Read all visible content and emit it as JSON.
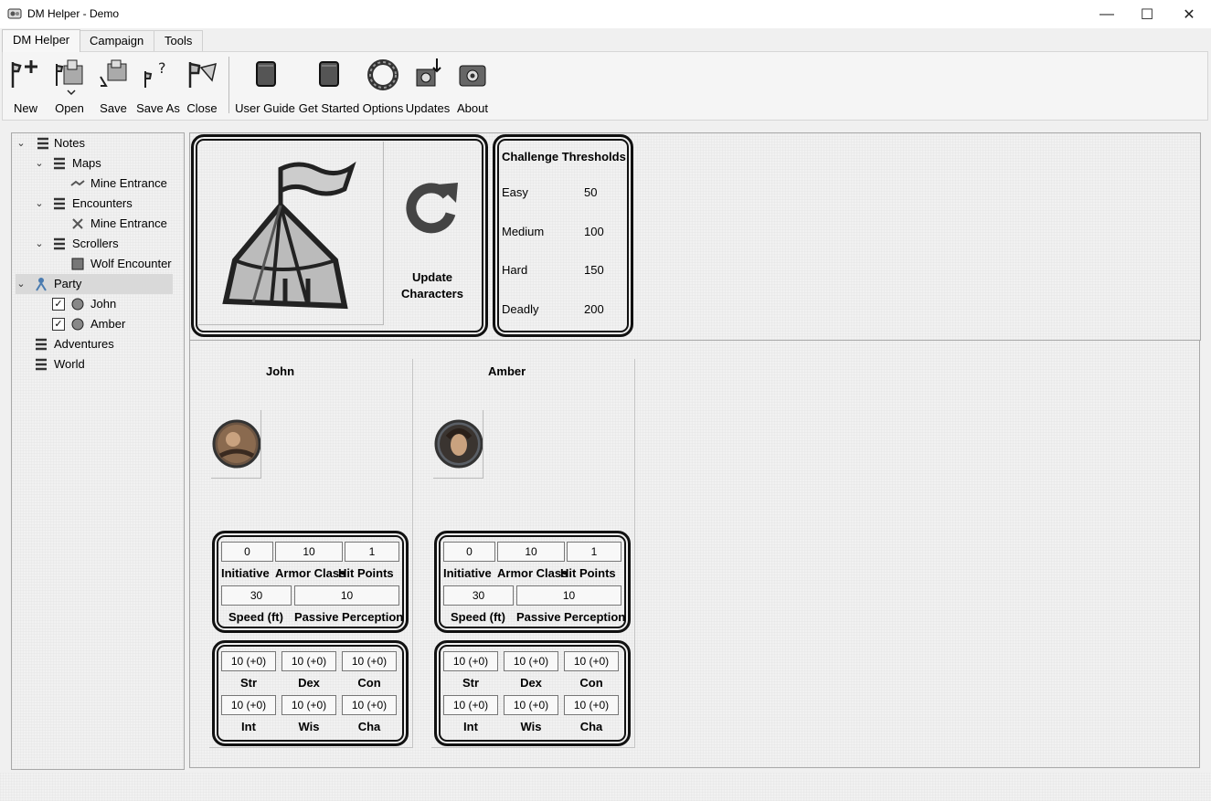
{
  "window": {
    "title": "DM Helper - Demo",
    "minimize": "—",
    "maximize": "☐",
    "close": "✕"
  },
  "tabs": [
    {
      "label": "DM Helper",
      "active": true
    },
    {
      "label": "Campaign",
      "active": false
    },
    {
      "label": "Tools",
      "active": false
    }
  ],
  "ribbon": {
    "file_buttons": [
      {
        "label": "New",
        "icon": "new-file-icon"
      },
      {
        "label": "Open",
        "icon": "open-file-icon"
      },
      {
        "label": "Save",
        "icon": "save-icon"
      },
      {
        "label": "Save As",
        "icon": "save-as-icon"
      },
      {
        "label": "Close",
        "icon": "close-file-icon"
      }
    ],
    "help_buttons": [
      {
        "label": "User Guide",
        "icon": "book-icon"
      },
      {
        "label": "Get Started",
        "icon": "book-icon"
      },
      {
        "label": "Options",
        "icon": "options-ring-icon"
      },
      {
        "label": "Updates",
        "icon": "updates-icon"
      },
      {
        "label": "About",
        "icon": "about-icon"
      }
    ]
  },
  "tree": {
    "notes": "Notes",
    "maps": "Maps",
    "maps_child": "Mine Entrance",
    "encounters": "Encounters",
    "encounters_child": "Mine Entrance",
    "scrollers": "Scrollers",
    "scrollers_child": "Wolf Encounter",
    "party": "Party",
    "party_member_1": "John",
    "party_member_2": "Amber",
    "adventures": "Adventures",
    "world": "World"
  },
  "party_panel": {
    "update_label_line1": "Update",
    "update_label_line2": "Characters"
  },
  "thresholds": {
    "title": "Challenge Thresholds",
    "rows": [
      {
        "label": "Easy",
        "value": "50"
      },
      {
        "label": "Medium",
        "value": "100"
      },
      {
        "label": "Hard",
        "value": "150"
      },
      {
        "label": "Deadly",
        "value": "200"
      }
    ]
  },
  "labels": {
    "initiative": "Initiative",
    "armor_class": "Armor Class",
    "hit_points": "Hit Points",
    "speed": "Speed (ft)",
    "passive_perception": "Passive Perception",
    "str": "Str",
    "dex": "Dex",
    "con": "Con",
    "int": "Int",
    "wis": "Wis",
    "cha": "Cha"
  },
  "characters": [
    {
      "name": "John",
      "initiative": "0",
      "armor_class": "10",
      "hit_points": "1",
      "speed": "30",
      "passive_perception": "10",
      "str": "10 (+0)",
      "dex": "10 (+0)",
      "con": "10 (+0)",
      "int": "10 (+0)",
      "wis": "10 (+0)",
      "cha": "10 (+0)"
    },
    {
      "name": "Amber",
      "initiative": "0",
      "armor_class": "10",
      "hit_points": "1",
      "speed": "30",
      "passive_perception": "10",
      "str": "10 (+0)",
      "dex": "10 (+0)",
      "con": "10 (+0)",
      "int": "10 (+0)",
      "wis": "10 (+0)",
      "cha": "10 (+0)"
    }
  ]
}
